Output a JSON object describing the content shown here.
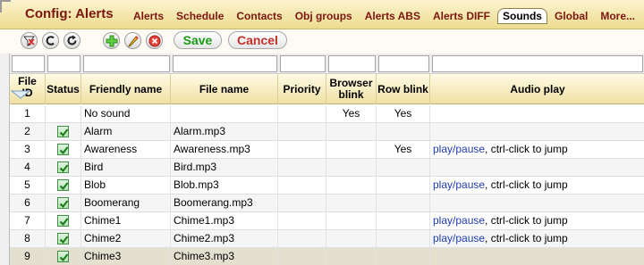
{
  "app": {
    "title": "Config: Alerts"
  },
  "menu": [
    {
      "label": "Alerts",
      "active": false
    },
    {
      "label": "Schedule",
      "active": false
    },
    {
      "label": "Contacts",
      "active": false
    },
    {
      "label": "Obj groups",
      "active": false
    },
    {
      "label": "Alerts ABS",
      "active": false
    },
    {
      "label": "Alerts DIFF",
      "active": false
    },
    {
      "label": "Sounds",
      "active": true
    },
    {
      "label": "Global",
      "active": false
    },
    {
      "label": "More...",
      "active": false
    }
  ],
  "toolbar": {
    "icons": [
      "filter-clear-icon",
      "clear-icon",
      "refresh-icon",
      "add-icon",
      "edit-icon",
      "delete-icon"
    ],
    "save_label": "Save",
    "cancel_label": "Cancel",
    "accent_green": "#1a9b1a",
    "accent_red": "#c0302a"
  },
  "table": {
    "headers": {
      "id": "File ID",
      "status": "Status",
      "friendly": "Friendly name",
      "file": "File name",
      "priority": "Priority",
      "browser_blink": "Browser blink",
      "row_blink": "Row blink",
      "audio": "Audio play"
    },
    "play_label": "play/pause",
    "play_hint": ", ctrl-click to jump",
    "rows": [
      {
        "id": "1",
        "status": false,
        "friendly": "No sound",
        "file": "",
        "priority": "",
        "browser_blink": "Yes",
        "row_blink": "Yes",
        "audio": "none"
      },
      {
        "id": "2",
        "status": true,
        "friendly": "Alarm",
        "file": "Alarm.mp3",
        "priority": "",
        "browser_blink": "",
        "row_blink": "",
        "audio": "wave"
      },
      {
        "id": "3",
        "status": true,
        "friendly": "Awareness",
        "file": "Awareness.mp3",
        "priority": "",
        "browser_blink": "",
        "row_blink": "Yes",
        "audio": "link"
      },
      {
        "id": "4",
        "status": true,
        "friendly": "Bird",
        "file": "Bird.mp3",
        "priority": "",
        "browser_blink": "",
        "row_blink": "",
        "audio": "wave"
      },
      {
        "id": "5",
        "status": true,
        "friendly": "Blob",
        "file": "Blob.mp3",
        "priority": "",
        "browser_blink": "",
        "row_blink": "",
        "audio": "link"
      },
      {
        "id": "6",
        "status": true,
        "friendly": "Boomerang",
        "file": "Boomerang.mp3",
        "priority": "",
        "browser_blink": "",
        "row_blink": "",
        "audio": "wave"
      },
      {
        "id": "7",
        "status": true,
        "friendly": "Chime1",
        "file": "Chime1.mp3",
        "priority": "",
        "browser_blink": "",
        "row_blink": "",
        "audio": "link"
      },
      {
        "id": "8",
        "status": true,
        "friendly": "Chime2",
        "file": "Chime2.mp3",
        "priority": "",
        "browser_blink": "",
        "row_blink": "",
        "audio": "link"
      },
      {
        "id": "9",
        "status": true,
        "friendly": "Chime3",
        "file": "Chime3.mp3",
        "priority": "",
        "browser_blink": "",
        "row_blink": "",
        "audio": "wave"
      }
    ]
  },
  "colors": {
    "title": "#7b1711",
    "wave_dark": "#8a0f7a",
    "wave_light": "#e58fd8",
    "link": "#1f3fb3"
  }
}
